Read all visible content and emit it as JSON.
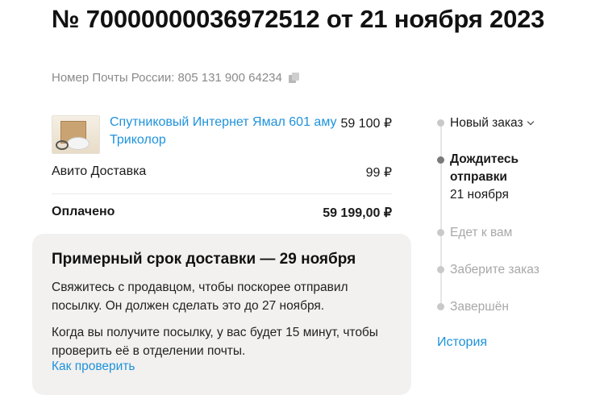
{
  "order": {
    "title": "№ 70000000036972512 от 21 ноября 2023",
    "tracking_label": "Номер Почты России: 805 131 900 64234"
  },
  "items": [
    {
      "name_line1": "Спутниковый Интернет Ямал 601 аму",
      "name_line2": "Триколор",
      "price": "59 100 ₽"
    }
  ],
  "delivery": {
    "label": "Авито Доставка",
    "price": "99 ₽"
  },
  "total": {
    "label": "Оплачено",
    "value": "59 199,00 ₽"
  },
  "info": {
    "title": "Примерный срок доставки — 29 ноября",
    "paragraph1": "Свяжитесь с продавцом, чтобы поскорее отправил посылку. Он должен сделать это до 27 ноября.",
    "paragraph2": "Когда вы получите посылку, у вас будет 15 минут, чтобы проверить её в отделении почты.",
    "link": "Как проверить"
  },
  "timeline": {
    "steps": [
      {
        "label": "Новый заказ",
        "state": "done"
      },
      {
        "label": "Дождитесь отправки",
        "date": "21 ноября",
        "state": "current"
      },
      {
        "label": "Едет к вам",
        "state": "pending"
      },
      {
        "label": "Заберите заказ",
        "state": "pending"
      },
      {
        "label": "Завершён",
        "state": "pending"
      }
    ],
    "history_link": "История"
  },
  "icons": {
    "copy": "copy-icon",
    "expand": "chevron-down-icon"
  },
  "colors": {
    "link": "#1e92db",
    "muted": "#a8a8a8",
    "card_bg": "#f2f1f0"
  }
}
